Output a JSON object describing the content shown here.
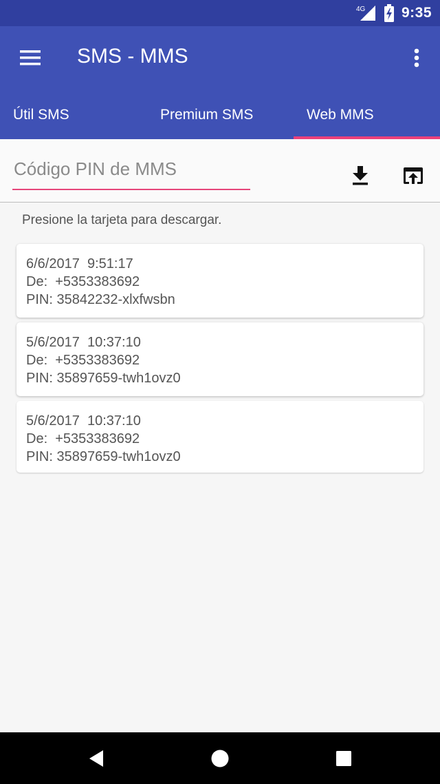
{
  "status_bar": {
    "network": "4G",
    "time": "9:35",
    "icons": [
      "signal-icon",
      "battery-charging-icon"
    ]
  },
  "app_bar": {
    "title": "SMS - MMS",
    "icons": [
      "menu-icon",
      "more-vert-icon"
    ]
  },
  "tabs": [
    {
      "label": "Útil SMS",
      "selected": false
    },
    {
      "label": "Premium SMS",
      "selected": false
    },
    {
      "label": "Web MMS",
      "selected": true
    }
  ],
  "pin": {
    "placeholder": "Código PIN de MMS",
    "value": "",
    "icons": [
      "download-icon",
      "upload-icon"
    ]
  },
  "hint": "Presione la tarjeta para descargar.",
  "messages": [
    {
      "date": "6/6/2017  9:51:17",
      "from": "De:  +5353383692",
      "pin": "PIN: 35842232-xlxfwsbn"
    },
    {
      "date": "5/6/2017  10:37:10",
      "from": "De:  +5353383692",
      "pin": "PIN: 35897659-twh1ovz0"
    },
    {
      "date": "5/6/2017  10:37:10",
      "from": "De:  +5353383692",
      "pin": "PIN: 35897659-twh1ovz0"
    }
  ],
  "nav_bar": {
    "icons": [
      "back-icon",
      "home-icon",
      "recents-icon"
    ]
  },
  "colors": {
    "status_bar": "#303f9f",
    "app_bar": "#3f51b5",
    "accent": "#ec407a"
  }
}
